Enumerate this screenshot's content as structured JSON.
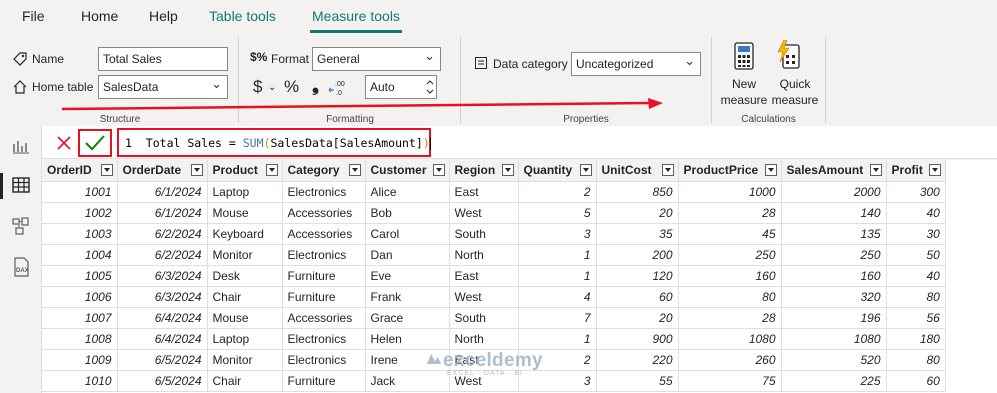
{
  "menu": {
    "file": "File",
    "home": "Home",
    "help": "Help",
    "table_tools": "Table tools",
    "measure_tools": "Measure tools"
  },
  "ribbon": {
    "structure": {
      "name_label": "Name",
      "name_value": "Total Sales",
      "home_table_label": "Home table",
      "home_table_value": "SalesData",
      "group_label": "Structure"
    },
    "formatting": {
      "format_label": "Format",
      "format_value": "General",
      "currency_symbol": "$",
      "percent_symbol": "%",
      "comma_symbol": "❟",
      "decimal_value": "Auto",
      "group_label": "Formatting"
    },
    "properties": {
      "data_category_label": "Data category",
      "data_category_value": "Uncategorized",
      "group_label": "Properties"
    },
    "calculations": {
      "new_measure_line1": "New",
      "new_measure_line2": "measure",
      "quick_measure_line1": "Quick",
      "quick_measure_line2": "measure",
      "group_label": "Calculations"
    }
  },
  "formula": {
    "line_number": "1",
    "text_before_fn": "Total Sales = ",
    "function": "SUM",
    "open_paren": "(",
    "argument": "SalesData[SalesAmount]",
    "close_paren": ")"
  },
  "table": {
    "columns": [
      "OrderID",
      "OrderDate",
      "Product",
      "Category",
      "Customer",
      "Region",
      "Quantity",
      "UnitCost",
      "ProductPrice",
      "SalesAmount",
      "Profit"
    ],
    "rows": [
      [
        "1001",
        "6/1/2024",
        "Laptop",
        "Electronics",
        "Alice",
        "East",
        "2",
        "850",
        "1000",
        "2000",
        "300"
      ],
      [
        "1002",
        "6/1/2024",
        "Mouse",
        "Accessories",
        "Bob",
        "West",
        "5",
        "20",
        "28",
        "140",
        "40"
      ],
      [
        "1003",
        "6/2/2024",
        "Keyboard",
        "Accessories",
        "Carol",
        "South",
        "3",
        "35",
        "45",
        "135",
        "30"
      ],
      [
        "1004",
        "6/2/2024",
        "Monitor",
        "Electronics",
        "Dan",
        "North",
        "1",
        "200",
        "250",
        "250",
        "50"
      ],
      [
        "1005",
        "6/3/2024",
        "Desk",
        "Furniture",
        "Eve",
        "East",
        "1",
        "120",
        "160",
        "160",
        "40"
      ],
      [
        "1006",
        "6/3/2024",
        "Chair",
        "Furniture",
        "Frank",
        "West",
        "4",
        "60",
        "80",
        "320",
        "80"
      ],
      [
        "1007",
        "6/4/2024",
        "Mouse",
        "Accessories",
        "Grace",
        "South",
        "7",
        "20",
        "28",
        "196",
        "56"
      ],
      [
        "1008",
        "6/4/2024",
        "Laptop",
        "Electronics",
        "Helen",
        "North",
        "1",
        "900",
        "1080",
        "1080",
        "180"
      ],
      [
        "1009",
        "6/5/2024",
        "Monitor",
        "Electronics",
        "Irene",
        "East",
        "2",
        "220",
        "260",
        "520",
        "80"
      ],
      [
        "1010",
        "6/5/2024",
        "Chair",
        "Furniture",
        "Jack",
        "West",
        "3",
        "55",
        "75",
        "225",
        "60"
      ]
    ]
  },
  "watermark": {
    "brand": "exceldemy",
    "tagline": "EXCEL · DATA · BI"
  },
  "colors": {
    "accent_teal": "#107c6f",
    "highlight_red": "#e81123",
    "commit_green": "#107c10"
  }
}
